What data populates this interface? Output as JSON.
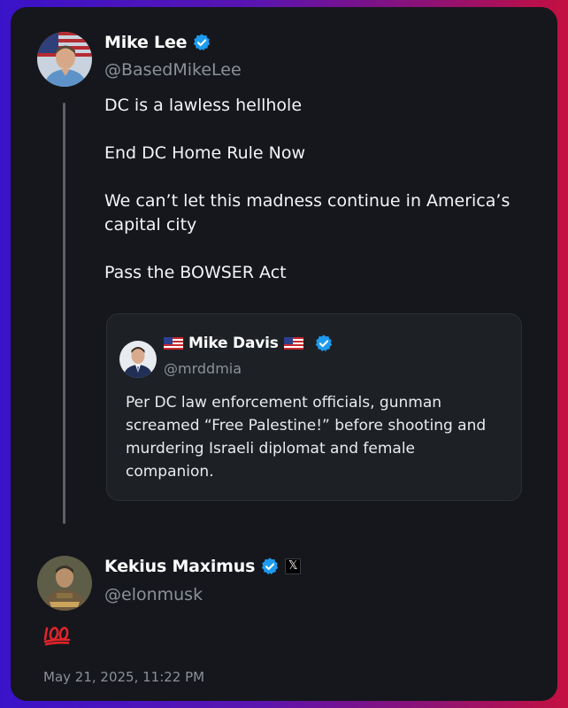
{
  "main_post": {
    "author_name": "Mike Lee",
    "author_handle": "@BasedMikeLee",
    "paragraphs": [
      "DC is a lawless hellhole",
      "End DC Home Rule Now",
      "We can’t let this madness continue in America’s capital city",
      "Pass the BOWSER Act"
    ]
  },
  "quoted_post": {
    "author_name": "Mike Davis",
    "author_flag": "us-flag-emoji",
    "author_handle": "@mrddmia",
    "text": "Per DC law enforcement officials, gunman screamed “Free Palestine!” before shooting and murdering Israeli diplomat and female companion."
  },
  "reply": {
    "author_name": "Kekius Maximus",
    "author_handle": "@elonmusk",
    "affiliation_badge": "𝕏",
    "content_icon": "hundred-points-emoji",
    "timestamp": "May 21, 2025, 11:22 PM"
  },
  "colors": {
    "card_background": "#15171c",
    "verified_blue": "#1d9bf0",
    "muted_text": "#8b9199",
    "hundred_red": "#e0242a"
  }
}
